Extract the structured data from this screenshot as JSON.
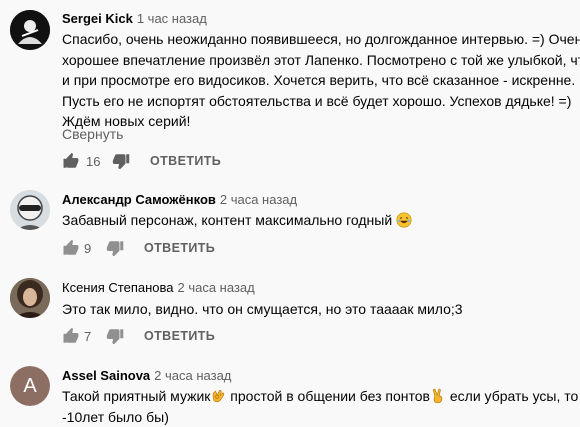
{
  "comments": [
    {
      "author": "Sergei Kick",
      "time": "1 час назад",
      "text_lines": [
        "Спасибо, очень неожиданно появившееся, но долгожданное интервью. =) Очень",
        "хорошее впечатление произвёл этот Лапенко. Посмотрено с той же улыбкой, что",
        "и при просмотре  его видосиков. Хочется верить, что всё сказанное - искренне.",
        "Пусть его не испортят обстоятельства и всё будет хорошо. Успехов дядьке! =)",
        "Ждём новых серий!"
      ],
      "collapse_label": "Свернуть",
      "likes": "16",
      "reply_label": "ОТВЕТИТЬ"
    },
    {
      "author": "Александр Саможёнков",
      "time": "2 часа назад",
      "text_lines": [
        "Забавный персонаж, контент максимально годный"
      ],
      "text_emoji": "laughing-emoji",
      "likes": "9",
      "reply_label": "ОТВЕТИТЬ"
    },
    {
      "author": "Ксения Степанова",
      "time": "2 часа назад",
      "text_lines": [
        "Это так мило, видно. что он смущается, но это тааaак мило;3"
      ],
      "likes": "7",
      "reply_label": "ОТВЕТИТЬ"
    },
    {
      "author": "Assel Sainova",
      "time": "2 часа назад",
      "avatar_letter": "A",
      "avatar_color": "#8d6e63",
      "text_parts": [
        "Такой приятный мужик",
        " простой в общении без понтов",
        " если убрать усы,  то"
      ],
      "text_line2": "-10лет было бы)"
    }
  ]
}
